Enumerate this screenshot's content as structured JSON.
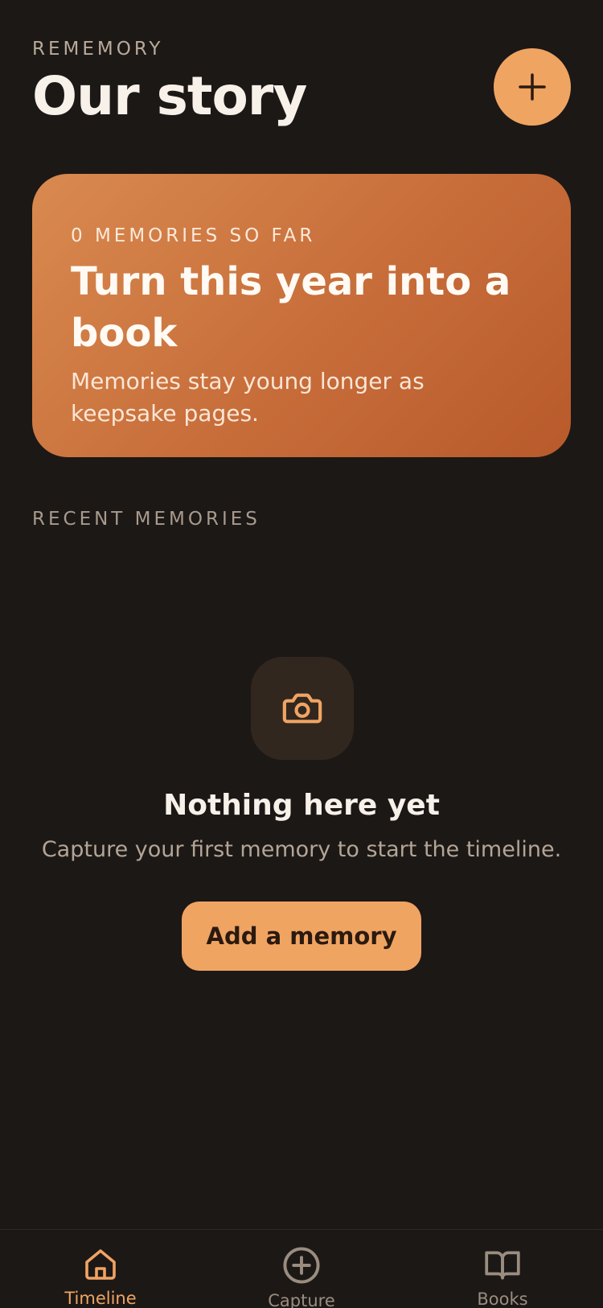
{
  "header": {
    "app_label": "REMEMORY",
    "title": "Our story",
    "add_button_icon": "plus-icon"
  },
  "hero": {
    "count_text": "0 MEMORIES SO FAR",
    "title": "Turn this year into a book",
    "subtitle": "Memories stay young longer as keepsake pages."
  },
  "recent": {
    "section_label": "RECENT MEMORIES"
  },
  "empty_state": {
    "icon": "camera-icon",
    "title": "Nothing here yet",
    "subtitle": "Capture your first memory to start the timeline.",
    "button_label": "Add a memory"
  },
  "nav": {
    "items": [
      {
        "label": "Timeline",
        "icon": "home-icon",
        "active": true
      },
      {
        "label": "Capture",
        "icon": "plus-circle-icon",
        "active": false
      },
      {
        "label": "Books",
        "icon": "book-icon",
        "active": false
      }
    ]
  },
  "colors": {
    "background": "#1c1816",
    "accent": "#f0a462",
    "hero_gradient_start": "#d98a4f",
    "hero_gradient_end": "#b85a2b"
  }
}
